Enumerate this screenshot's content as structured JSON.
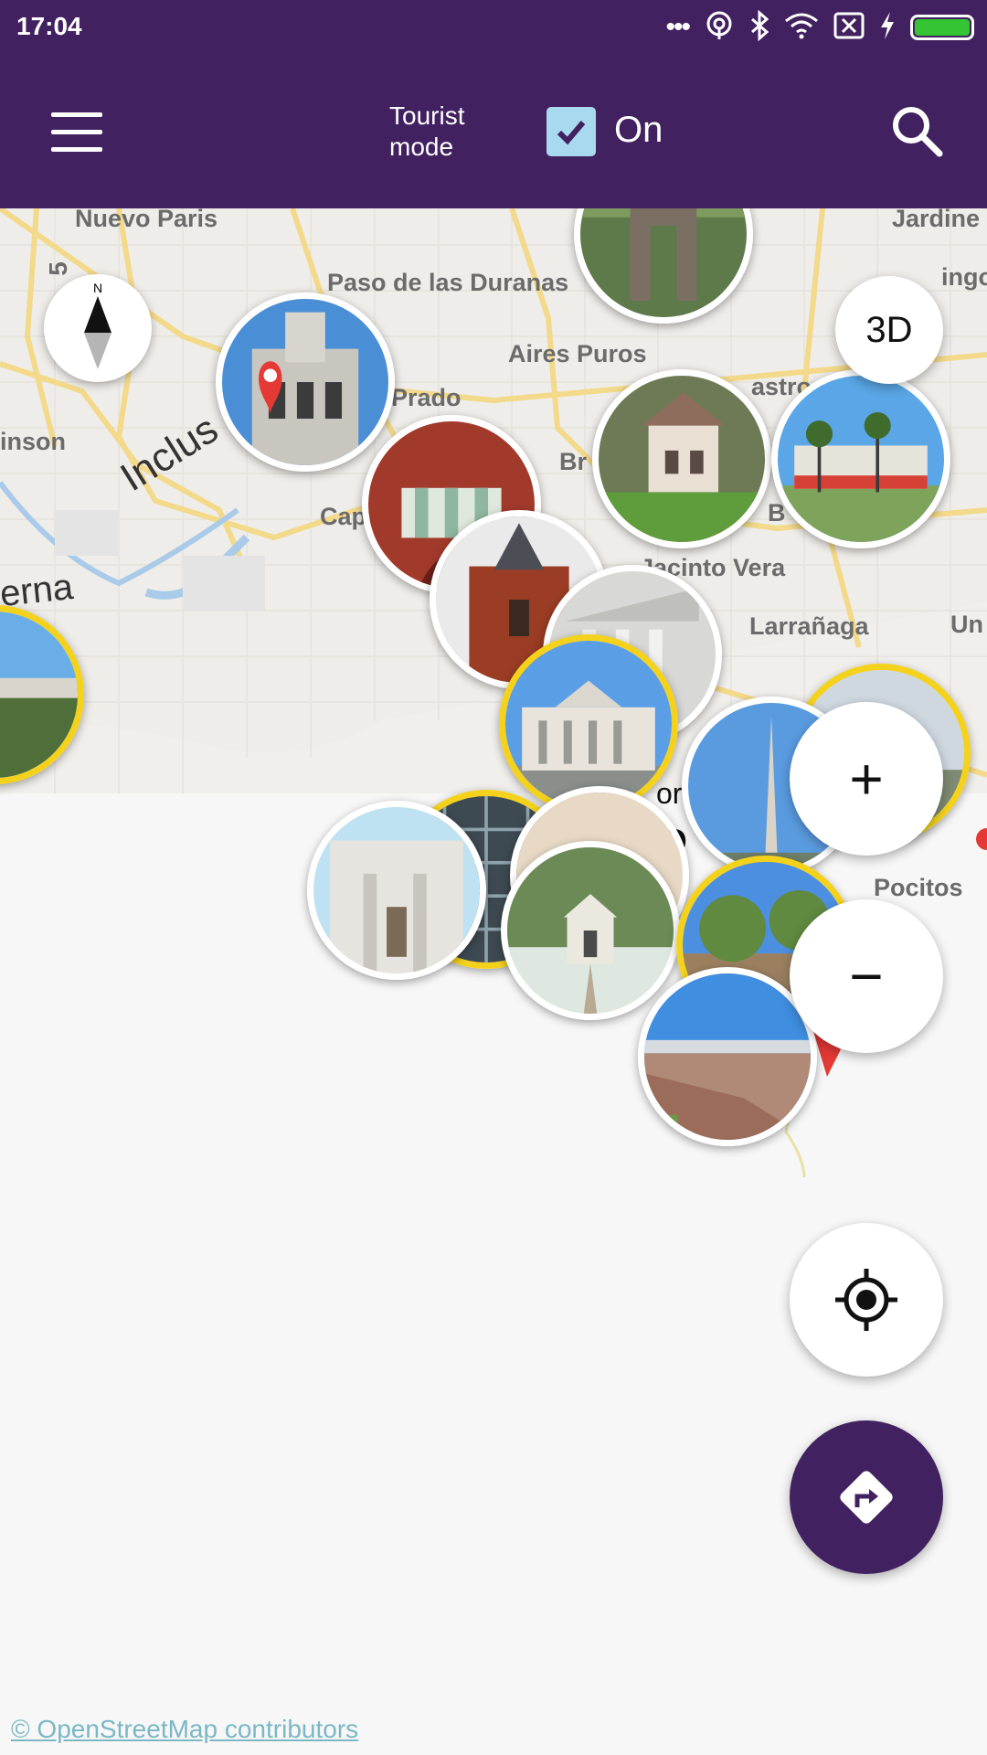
{
  "status_bar": {
    "time": "17:04",
    "icons": [
      "dots-icon",
      "hotspot-icon",
      "bluetooth-icon",
      "wifi-icon",
      "no-sim-icon",
      "charging-icon",
      "battery-icon"
    ]
  },
  "header": {
    "menu_icon": "hamburger-menu-icon",
    "tourist_mode_label": "Tourist mode",
    "tourist_mode_checked": true,
    "tourist_mode_state": "On",
    "search_icon": "search-icon",
    "bar_color": "#41215f"
  },
  "map": {
    "labels": {
      "nuevo_paris": "Nuevo Paris",
      "paso_duranas": "Paso de las Duranas",
      "jardines": "Jardine",
      "aires_puros": "Aires Puros",
      "prado": "Prado",
      "inson": "inson",
      "inclusion": "Inclus",
      "castro": "astro C",
      "cap": "Cap",
      "br": "Br",
      "b": "B",
      "jacinto_vera": "Jacinto Vera",
      "larranaga": "Larrañaga",
      "un": "Un",
      "erna": "erna",
      "or": "or",
      "eo": "eo",
      "pocitos": "Pocitos",
      "five": "5",
      "inge": "ingo"
    },
    "attraction_count": 17,
    "pin_border_highlight": "#f4d21c"
  },
  "controls": {
    "compass_label": "N",
    "three_d_label": "3D",
    "zoom_in_label": "+",
    "zoom_out_label": "−",
    "locate_icon": "my-location-icon",
    "route_icon": "directions-icon"
  },
  "attribution": "© OpenStreetMap contributors"
}
